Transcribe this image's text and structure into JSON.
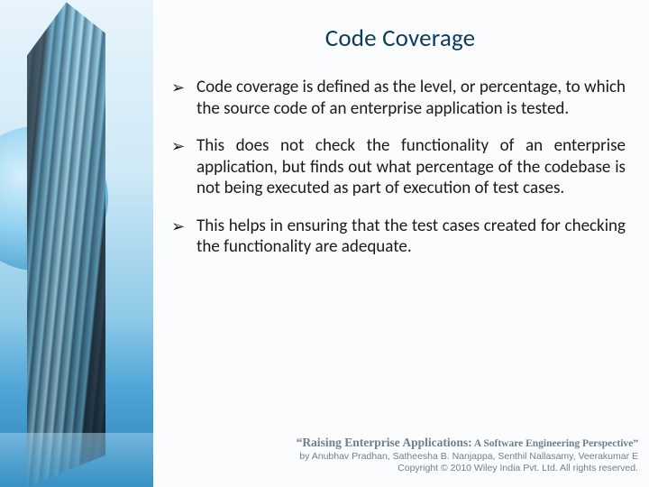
{
  "title": "Code Coverage",
  "bullets": [
    "Code coverage is defined as the level, or percentage, to which the source code of an enterprise application is tested.",
    "This does not check the functionality of an enterprise application, but finds out what percentage of the codebase is not being executed as part of execution of test cases.",
    "This helps in ensuring that the test cases created for checking the functionality are adequate."
  ],
  "footer": {
    "book_title_main": "“Raising Enterprise Applications:",
    "book_title_sub": " A Software Engineering Perspective”",
    "authors": "by Anubhav Pradhan, Satheesha B. Nanjappa, Senthil Nallasamy, Veerakumar E",
    "copyright": "Copyright © 2010 Wiley India Pvt. Ltd.  All rights reserved."
  }
}
